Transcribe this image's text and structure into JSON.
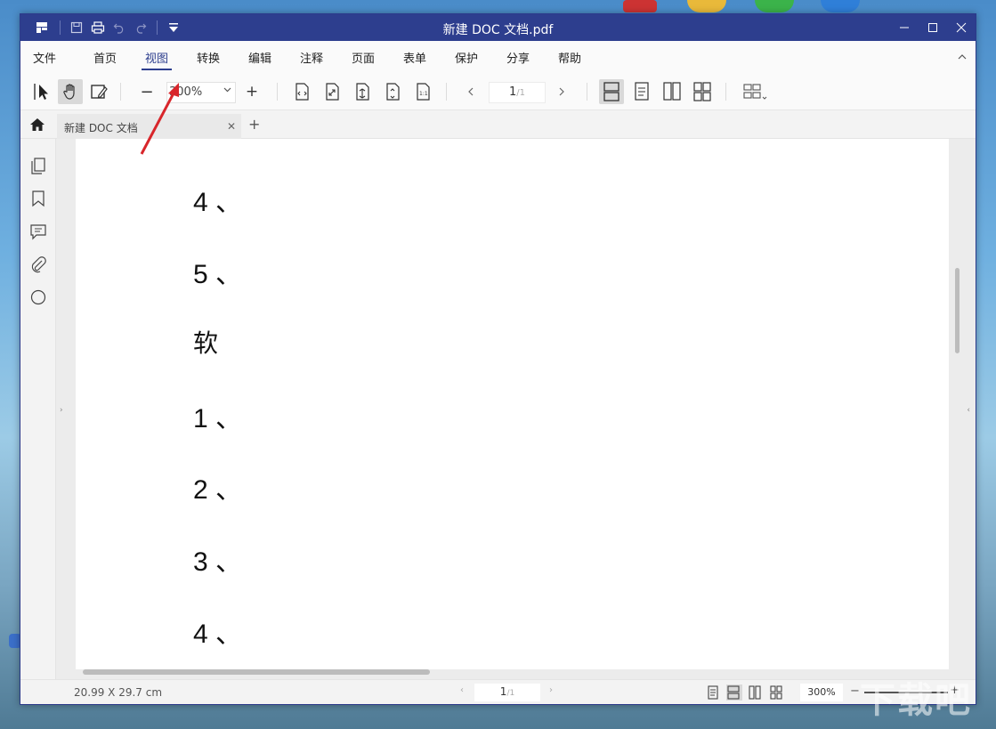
{
  "window": {
    "title": "新建 DOC 文档.pdf"
  },
  "menu": {
    "items": [
      "文件",
      "首页",
      "视图",
      "转换",
      "编辑",
      "注释",
      "页面",
      "表单",
      "保护",
      "分享",
      "帮助"
    ],
    "active_index": 2
  },
  "toolbar": {
    "zoom_value": "300%",
    "page_current": "1",
    "page_total": "/1",
    "zoom_minus": "−",
    "zoom_plus": "+"
  },
  "tabs": [
    {
      "label": "新建 DOC 文档"
    }
  ],
  "document": {
    "lines": [
      "4 、",
      "5 、",
      "软",
      "1 、",
      "2 、",
      "3 、",
      "4 、"
    ]
  },
  "status": {
    "dimensions": "20.99 X 29.7 cm",
    "page_current": "1",
    "page_total": "/1",
    "zoom": "300%"
  },
  "icons": {
    "logo": "app-logo-icon",
    "save": "save-icon",
    "print": "print-icon",
    "undo": "undo-icon",
    "redo": "redo-icon",
    "quick_access": "dropdown-icon"
  },
  "colors": {
    "titlebar": "#2d3e8e",
    "accent": "#2d3e8e",
    "annotation_arrow": "#d8262b"
  }
}
